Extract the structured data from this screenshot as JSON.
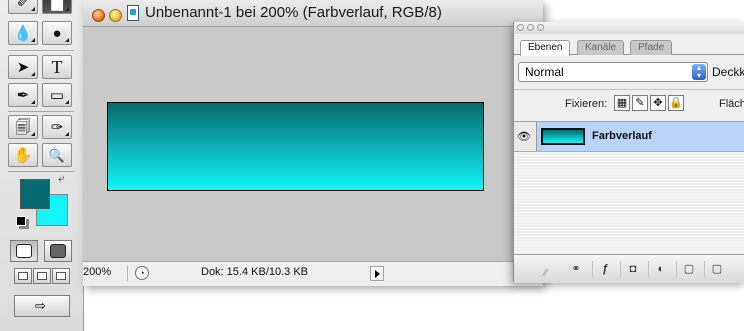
{
  "colors": {
    "foreground": "#066b70",
    "background": "#14f4f8",
    "gradient_top": "#056a6e",
    "gradient_bottom": "#12f5f7",
    "layer_selection": "#b8d4f8"
  },
  "toolbox": {
    "tools": [
      {
        "name": "brush-tool-icon",
        "glyph": "✐"
      },
      {
        "name": "eraser-tool-icon",
        "glyph": "▆"
      },
      {
        "name": "blur-tool-icon",
        "glyph": "💧"
      },
      {
        "name": "dodge-tool-icon",
        "glyph": "●"
      },
      {
        "name": "path-selection-tool-icon",
        "glyph": "➤"
      },
      {
        "name": "type-tool-icon",
        "glyph": "T"
      },
      {
        "name": "pen-tool-icon",
        "glyph": "✒"
      },
      {
        "name": "rectangle-tool-icon",
        "glyph": "▭"
      },
      {
        "name": "notes-tool-icon",
        "glyph": "🗐"
      },
      {
        "name": "eyedropper-tool-icon",
        "glyph": "✑"
      },
      {
        "name": "hand-tool-icon",
        "glyph": "✋"
      },
      {
        "name": "zoom-tool-icon",
        "glyph": "🔍"
      }
    ],
    "swap_icon": "⤶",
    "jump_icon": "⇨"
  },
  "document": {
    "title": "Unbenannt-1 bei 200% (Farbverlauf, RGB/8)",
    "zoom": "200%",
    "info": "Dok: 15.4 KB/10.3 KB"
  },
  "layers_palette": {
    "tabs": [
      "Ebenen",
      "Kanäle",
      "Pfade"
    ],
    "blend_mode": "Normal",
    "opacity_label": "Deckk",
    "lock_label": "Fixieren:",
    "lock_icons": [
      "▦",
      "✎",
      "✥",
      "🔒"
    ],
    "fill_label": "Fläch",
    "layer_name": "Farbverlauf",
    "eye_icon": "👁",
    "footer_icons": [
      "⚭",
      "ƒ",
      "◘",
      "◐",
      "▢",
      "▢"
    ],
    "grip_icon": "⁄⁄"
  }
}
